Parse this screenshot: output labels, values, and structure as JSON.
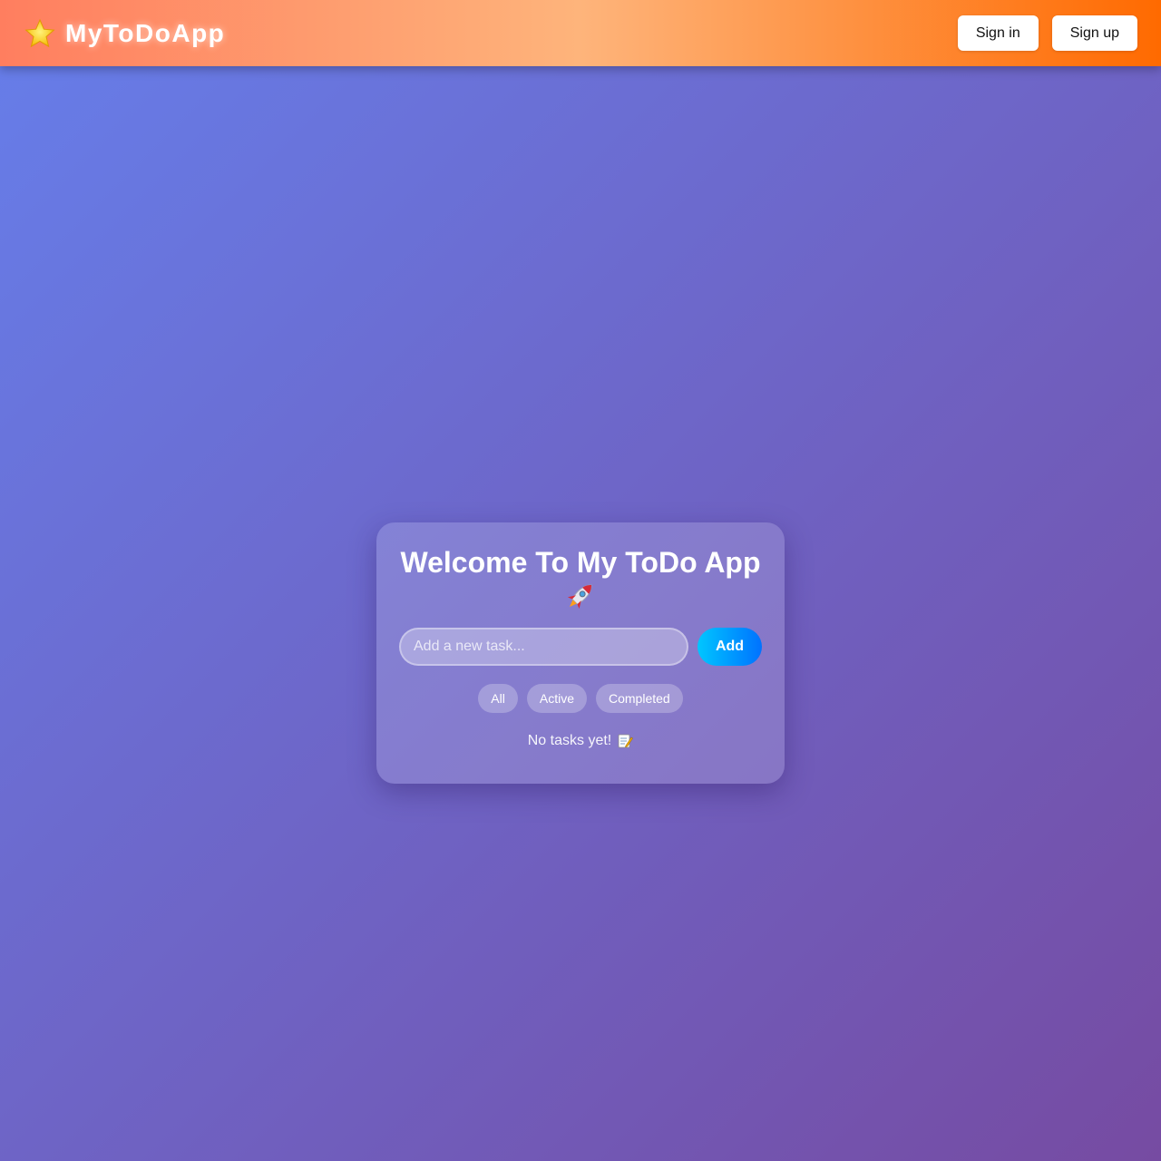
{
  "header": {
    "brand_name": "MyToDoApp",
    "brand_icon": "star-icon",
    "sign_in_label": "Sign in",
    "sign_up_label": "Sign up"
  },
  "card": {
    "title": "Welcome To My ToDo App",
    "title_icon": "rocket-icon",
    "task_input": {
      "placeholder": "Add a new task...",
      "value": ""
    },
    "add_label": "Add",
    "filters": [
      {
        "label": "All"
      },
      {
        "label": "Active"
      },
      {
        "label": "Completed"
      }
    ],
    "empty_message": "No tasks yet!",
    "empty_icon": "memo-icon"
  },
  "colors": {
    "background_start": "#667eea",
    "background_end": "#764ba2",
    "header_start": "#ff7e5f",
    "header_mid": "#feb47b",
    "header_end": "#ff6a00",
    "add_button_start": "#00c6ff",
    "add_button_end": "#0072ff"
  }
}
